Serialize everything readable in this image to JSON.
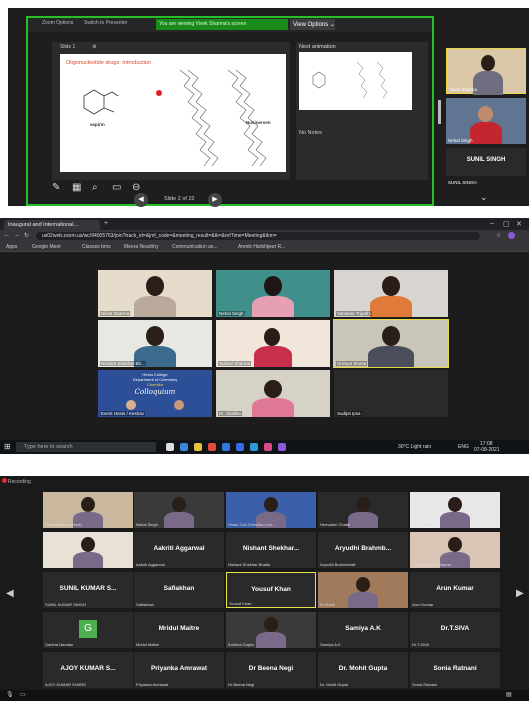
{
  "panel1": {
    "topstrip": {
      "tab1": "Zoom Options",
      "tab2": "Switch to Presenter",
      "banner": "You are viewing Vivek Sharma's screen",
      "view_options": "View Options"
    },
    "ppt": {
      "slide_counter_left": "Slide 1",
      "timer": "0:45 AM",
      "slide_title": "Oligonucleotide drugs: Introduction",
      "label_aspirin": "aspirin",
      "label_nusinersen": "Nusinersen",
      "slide_nav": "Slide 2 of 22"
    },
    "notes": {
      "next_title": "Next animation",
      "no_notes": "No Notes"
    },
    "videos": [
      {
        "name": "Vivek Sharma"
      },
      {
        "name": "Nehal Singh"
      },
      {
        "name": "SUNIL SINGH"
      },
      {
        "name": "SUNIL SINGH"
      }
    ]
  },
  "panel2": {
    "tab_title": "Inaugural and International...",
    "url": "us02web.zoom.us/wc/94005763/join?track_id=&jmf_code=&meeting_result=&tk=&refTime=Meeting&tkm=",
    "bookmarks": [
      "Apps",
      "Google Meet",
      "Classes bms",
      "Meera Nearbhy",
      "Communication as...",
      "Anmik Harbhijeet R..."
    ],
    "tiles": [
      {
        "name": "Nikita Sharma"
      },
      {
        "name": "Nehal Singh"
      },
      {
        "name": "Vandana Tripathi"
      },
      {
        "name": "Nishant Shekhar Bh..."
      },
      {
        "name": "Suhani Sharma"
      },
      {
        "name": "Nishant Bhatia"
      },
      {
        "name": "Event Hosts / Keshav"
      },
      {
        "name": "Dr. Shalika"
      },
      {
        "name": "Sudipti Ipsa"
      }
    ],
    "poster": {
      "college": "Hindu College",
      "dept": "Department of Chemistry",
      "org": "Chemika",
      "title": "Colloquium"
    },
    "taskbar": {
      "search": "Type here to search",
      "weather": "30°C Light rain",
      "lang": "ENG",
      "time": "17:08",
      "date": "07-08-2021"
    }
  },
  "panel3": {
    "topline": "Recording",
    "rows": [
      [
        {
          "big": "",
          "name": "Vivek Sharma (Host)"
        },
        {
          "big": "",
          "name": "Nehal Singh"
        },
        {
          "big": "",
          "name": "Hindu Coll Chemika Live..."
        },
        {
          "big": "",
          "name": "Hemadhri Chattri"
        },
        {
          "big": "",
          "name": "Vivek Sharma"
        }
      ],
      [
        {
          "big": "",
          "name": "Nikita Sharma"
        },
        {
          "big": "Aakriti Aggarwal",
          "name": "Aakriti Aggarwal"
        },
        {
          "big": "Nishant Shekhar...",
          "name": "Nishant Shekhar Bhatia"
        },
        {
          "big": "Aryudhi Brahmb...",
          "name": "Aryudhi Brahmbhatt"
        },
        {
          "big": "",
          "name": "Sushil Kumar Sharma"
        }
      ],
      [
        {
          "big": "SUNIL KUMAR S...",
          "name": "SUNIL KUMAR SINGH"
        },
        {
          "big": "Safiakhan",
          "name": "Safiakhan"
        },
        {
          "big": "Yousuf Khan",
          "name": "Yousuf Khan"
        },
        {
          "big": "",
          "name": "Dr Rohit"
        },
        {
          "big": "Arun Kumar",
          "name": "Arun Kumar"
        }
      ],
      [
        {
          "big": "",
          "name": "Garima Nandan"
        },
        {
          "big": "Mridul Maitre",
          "name": "Mridul Maitre"
        },
        {
          "big": "",
          "name": "Kohima Gupta"
        },
        {
          "big": "Samiya A.K",
          "name": "Samiya A.K"
        },
        {
          "big": "Dr.T.SIVA",
          "name": "Dr.T.SIVA"
        }
      ],
      [
        {
          "big": "AJOY KUMAR S...",
          "name": "AJOY KUMAR SHARD"
        },
        {
          "big": "Priyanka Amrawat",
          "name": "Priyanka Amrawat"
        },
        {
          "big": "Dr Beena  Negi",
          "name": "Dr Beena  Negi"
        },
        {
          "big": "Dr. Mohit Gupta",
          "name": "Dr. Mohit Gupta"
        },
        {
          "big": "Sonia Ratnani",
          "name": "Sonia Ratnani"
        }
      ]
    ],
    "g_avatar_letter": "G"
  }
}
